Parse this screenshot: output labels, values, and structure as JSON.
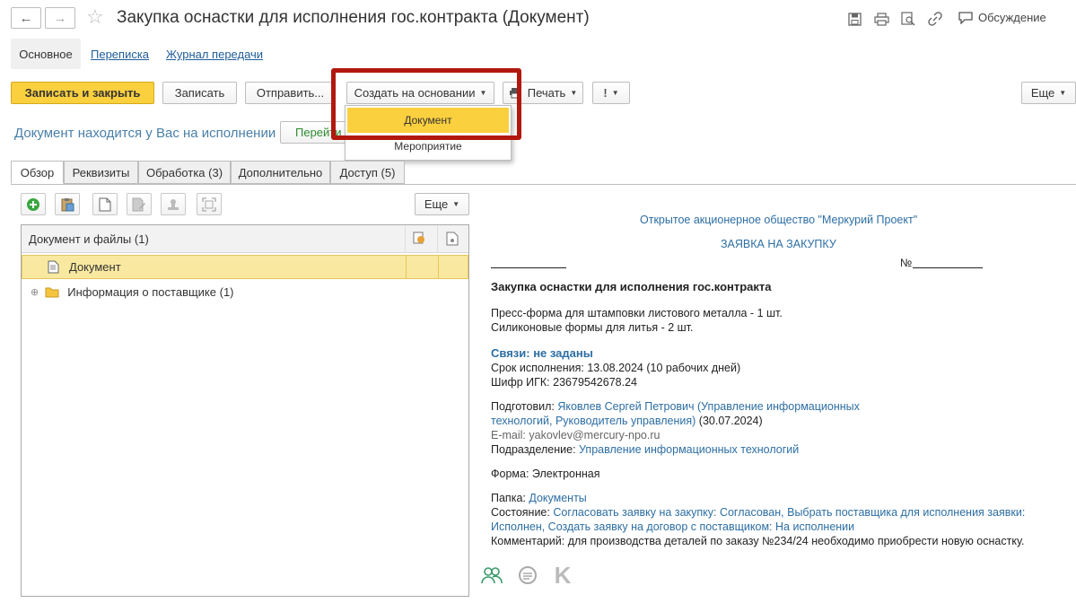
{
  "window": {
    "title": "Закупка оснастки для исполнения гос.контракта (Документ)",
    "discussion_label": "Обсуждение"
  },
  "top_tabs": {
    "main": "Основное",
    "correspondence": "Переписка",
    "transfer_log": "Журнал передачи"
  },
  "toolbar": {
    "save_close": "Записать и закрыть",
    "save": "Записать",
    "send": "Отправить...",
    "create_based": "Создать на основании",
    "print": "Печать",
    "more": "Еще"
  },
  "dropdown": {
    "items": [
      "Документ",
      "Мероприятие"
    ]
  },
  "status": {
    "text": "Документ находится у Вас на исполнении",
    "goto_button": "Перейти"
  },
  "tabs": [
    "Обзор",
    "Реквизиты",
    "Обработка (3)",
    "Дополнительно",
    "Доступ (5)"
  ],
  "files": {
    "more": "Еще",
    "header": "Документ и файлы (1)",
    "rows": [
      {
        "label": "Документ"
      },
      {
        "label": "Информация о поставщике (1)"
      }
    ]
  },
  "preview": {
    "company": "Открытое акционерное общество \"Меркурий Проект\"",
    "doc_type": "ЗАЯВКА НА ЗАКУПКУ",
    "number_prefix": "№",
    "subject": "Закупка оснастки для исполнения гос.контракта",
    "items": [
      "Пресс-форма для штамповки листового металла - 1 шт.",
      "Силиконовые формы для литья - 2 шт."
    ],
    "links_heading": "Связи: не заданы",
    "deadline_label": "Срок исполнения:",
    "deadline_value": "13.08.2024 (10 рабочих дней)",
    "igk_label": "Шифр ИГК:",
    "igk_value": "23679542678.24",
    "prepared_label": "Подготовил:",
    "prepared_value_1": "Яковлев Сергей Петрович (Управление информационных",
    "prepared_value_2": "технологий, Руководитель управления)",
    "prepared_date": "(30.07.2024)",
    "email": "E-mail: yakovlev@mercury-npo.ru",
    "department_label": "Подразделение:",
    "department_value": "Управление информационных технологий",
    "form_label": "Форма:",
    "form_value": "Электронная",
    "folder_label": "Папка:",
    "folder_value": "Документы",
    "state_label": "Состояние:",
    "state_value_1": "Согласовать заявку на закупку: Согласован, Выбрать поставщика для исполнения заявки:",
    "state_value_2": "Исполнен, Создать заявку на договор с поставщиком: На исполнении",
    "comment_label": "Комментарий:",
    "comment_value": "для производства деталей по заказу №234/24 необходимо приобрести новую оснастку."
  },
  "colors": {
    "accent_yellow": "#fbd03f",
    "link_blue": "#2d6ea3",
    "highlight_red": "#b2180e",
    "status_green": "#2e8b2e"
  }
}
